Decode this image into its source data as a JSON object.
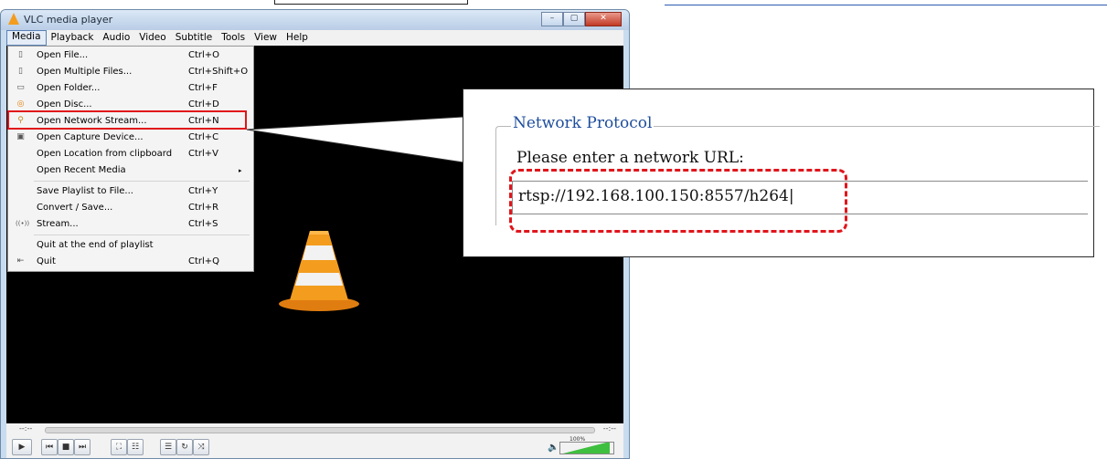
{
  "window": {
    "title": "VLC media player",
    "buttons": [
      "–",
      "▢",
      "✕"
    ]
  },
  "menubar": {
    "items": [
      "Media",
      "Playback",
      "Audio",
      "Video",
      "Subtitle",
      "Tools",
      "View",
      "Help"
    ],
    "active": "Media"
  },
  "media_menu": {
    "items": [
      {
        "label": "Open File...",
        "shortcut": "Ctrl+O",
        "icon": "file-icon"
      },
      {
        "label": "Open Multiple Files...",
        "shortcut": "Ctrl+Shift+O",
        "icon": "files-icon"
      },
      {
        "label": "Open Folder...",
        "shortcut": "Ctrl+F",
        "icon": "folder-icon"
      },
      {
        "label": "Open Disc...",
        "shortcut": "Ctrl+D",
        "icon": "disc-icon"
      },
      {
        "label": "Open Network Stream...",
        "shortcut": "Ctrl+N",
        "icon": "network-icon"
      },
      {
        "label": "Open Capture Device...",
        "shortcut": "Ctrl+C",
        "icon": "capture-icon"
      },
      {
        "label": "Open Location from clipboard",
        "shortcut": "Ctrl+V",
        "icon": ""
      },
      {
        "label": "Open Recent Media",
        "shortcut": "",
        "icon": "",
        "submenu": "▸"
      },
      {
        "label": "Save Playlist to File...",
        "shortcut": "Ctrl+Y",
        "icon": ""
      },
      {
        "label": "Convert / Save...",
        "shortcut": "Ctrl+R",
        "icon": ""
      },
      {
        "label": "Stream...",
        "shortcut": "Ctrl+S",
        "icon": "stream-icon"
      },
      {
        "label": "Quit at the end of playlist",
        "shortcut": "",
        "icon": ""
      },
      {
        "label": "Quit",
        "shortcut": "Ctrl+Q",
        "icon": "quit-icon"
      }
    ],
    "highlighted": "Open Network Stream..."
  },
  "seekbar": {
    "time_left": "--:--",
    "time_right": "--:--"
  },
  "controls": {
    "volume_label": "100%"
  },
  "network_dialog": {
    "group_title": "Network Protocol",
    "prompt": "Please enter a network URL:",
    "url_value": "rtsp://192.168.100.150:8557/h264|"
  },
  "colors": {
    "highlight": "#e0151b",
    "legend": "#1e4d9c",
    "cone": "#f39c1e"
  }
}
